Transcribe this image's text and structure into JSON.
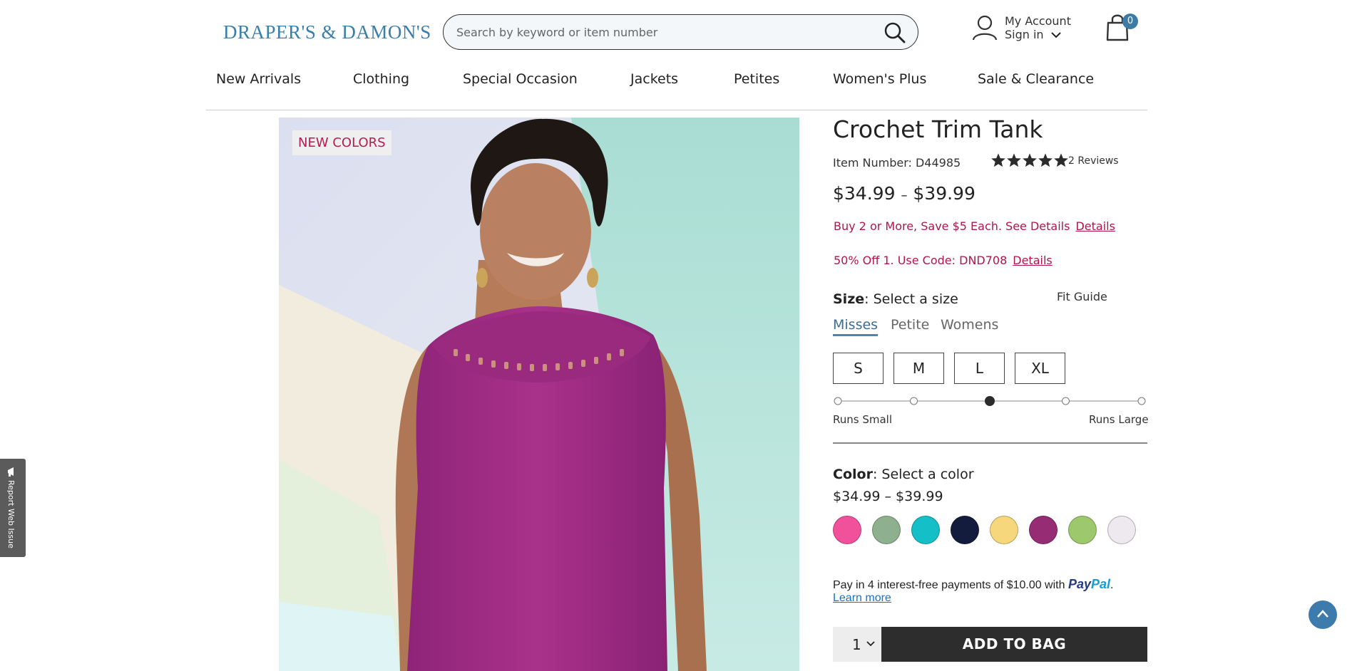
{
  "header": {
    "logo": "DRAPER'S & DAMON'S",
    "search_placeholder": "Search by keyword or item number",
    "account_label": "My Account",
    "signin_label": "Sign in",
    "cart_count": "0"
  },
  "nav": {
    "items": [
      "New Arrivals",
      "Clothing",
      "Special Occasion",
      "Jackets",
      "Petites",
      "Women's Plus",
      "Sale & Clearance"
    ]
  },
  "image": {
    "badge": "NEW COLORS"
  },
  "report_tab": "Report Web Issue",
  "product": {
    "title": "Crochet Trim Tank",
    "item_number": "Item Number: D44985",
    "rating": 5,
    "reviews": "2 Reviews",
    "price_low": "$34.99",
    "price_sep": "–",
    "price_high": "$39.99",
    "promos": [
      {
        "text": "Buy 2 or More, Save $5 Each. See Details",
        "link": "Details"
      },
      {
        "text": "50% Off 1. Use Code: DND708",
        "link": "Details"
      }
    ],
    "size_label": "Size",
    "size_value": ": Select a size",
    "fit_guide": "Fit Guide",
    "size_tabs": [
      "Misses",
      "Petite",
      "Womens"
    ],
    "active_size_tab": "Misses",
    "sizes": [
      "S",
      "M",
      "L",
      "XL"
    ],
    "fit_scale": {
      "positions": 5,
      "selected_index": 2
    },
    "runs_small": "Runs Small",
    "runs_large": "Runs Large",
    "color_label": "Color",
    "color_value": ": Select a color",
    "color_price": "$34.99 – $39.99",
    "colors": [
      "#f0519a",
      "#8fb08e",
      "#15bfc8",
      "#141c3d",
      "#f7d77b",
      "#962c74",
      "#9ec86c",
      "#eee9ef"
    ],
    "paypal_text": "Pay in 4 interest-free payments of $10.00 with",
    "paypal_brand_1": "Pay",
    "paypal_brand_2": "Pal",
    "paypal_period": ".",
    "learn_more": "Learn more",
    "quantity": "1",
    "add_to_bag": "ADD TO BAG"
  }
}
